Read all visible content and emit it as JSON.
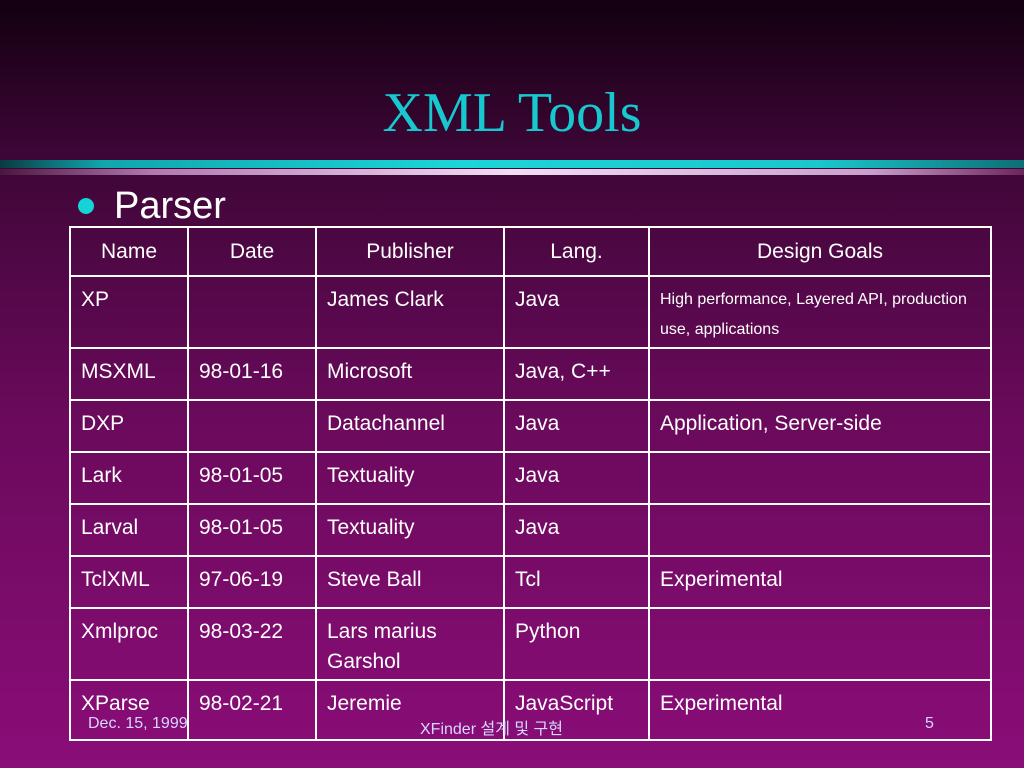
{
  "slide": {
    "title": "XML Tools",
    "bullet": "Parser",
    "colors": {
      "title": "#17c8cf",
      "bullet": "#16d3d7",
      "table_text": "#ffffff",
      "footer_text": "#d7d7ff"
    }
  },
  "table": {
    "headers": [
      "Name",
      "Date",
      "Publisher",
      "Lang.",
      "Design Goals"
    ],
    "rows": [
      [
        "XP",
        "",
        "James Clark",
        "Java",
        "High performance, Layered API, production use, applications"
      ],
      [
        "MSXML",
        "98-01-16",
        "Microsoft",
        "Java, C++",
        ""
      ],
      [
        "DXP",
        "",
        "Datachannel",
        "Java",
        "Application, Server-side"
      ],
      [
        "Lark",
        "98-01-05",
        "Textuality",
        "Java",
        ""
      ],
      [
        "Larval",
        "98-01-05",
        "Textuality",
        "Java",
        ""
      ],
      [
        "TclXML",
        "97-06-19",
        "Steve Ball",
        "Tcl",
        "Experimental"
      ],
      [
        "Xmlproc",
        "98-03-22",
        "Lars marius Garshol",
        "Python",
        ""
      ],
      [
        "XParse",
        "98-02-21",
        "Jeremie",
        "JavaScript",
        "Experimental"
      ]
    ]
  },
  "footer": {
    "date": "Dec. 15, 1999",
    "center": "XFinder 설계 및 구현",
    "page": "5"
  }
}
